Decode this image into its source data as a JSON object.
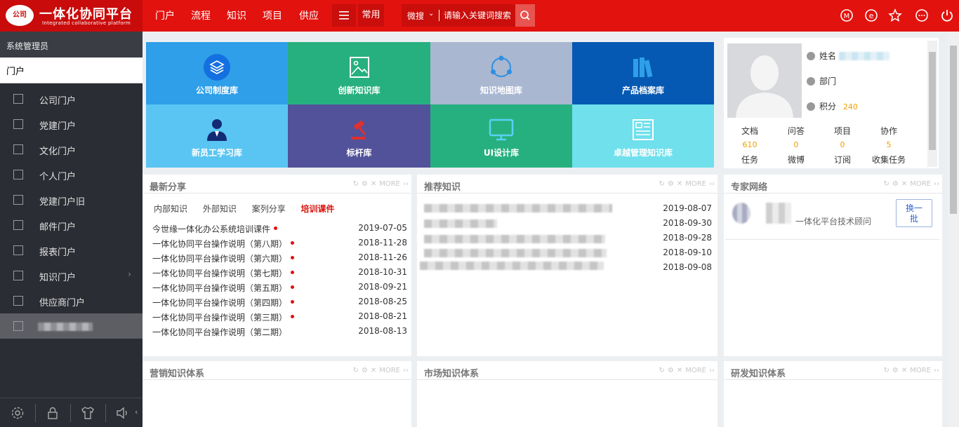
{
  "app": {
    "title": "一体化协同平台",
    "subtitle": "Integrated collaborative platform",
    "seal_text": "公司"
  },
  "topnav": [
    "门户",
    "流程",
    "知识",
    "项目",
    "供应"
  ],
  "toolbar": {
    "menu_icon": "menu-icon",
    "common_label": "常用"
  },
  "search": {
    "scope": "微搜",
    "placeholder": "请输入关键词搜索"
  },
  "top_icons": [
    "m-icon",
    "e-icon",
    "star-icon",
    "more-icon",
    "power-icon"
  ],
  "sidebar": {
    "user": "系统管理员",
    "section": "门户",
    "items": [
      {
        "label": "公司门户"
      },
      {
        "label": "党建门户"
      },
      {
        "label": "文化门户"
      },
      {
        "label": "个人门户"
      },
      {
        "label": "党建门户旧"
      },
      {
        "label": "邮件门户"
      },
      {
        "label": "报表门户"
      },
      {
        "label": "知识门户"
      },
      {
        "label": "供应商门户"
      }
    ],
    "bottom_icons": [
      "settings-icon",
      "lock-icon",
      "shirt-icon",
      "speaker-icon"
    ]
  },
  "tiles": [
    {
      "label": "公司制度库",
      "color": "#2e9fe8"
    },
    {
      "label": "创新知识库",
      "color": "#27b07f"
    },
    {
      "label": "知识地图库",
      "color": "#a9b7d1"
    },
    {
      "label": "产品档案库",
      "color": "#0559b3"
    },
    {
      "label": "新员工学习库",
      "color": "#5ac5f2"
    },
    {
      "label": "标杆库",
      "color": "#52529a"
    },
    {
      "label": "UI设计库",
      "color": "#27b07f"
    },
    {
      "label": "卓越管理知识库",
      "color": "#6fe0ec"
    }
  ],
  "profile": {
    "name_label": "姓名",
    "dept_label": "部门",
    "points_label": "积分",
    "points_value": "240",
    "stats_row1": [
      "文档",
      "问答",
      "项目",
      "协作"
    ],
    "stats_values": [
      "610",
      "0",
      "0",
      "5"
    ],
    "stats_row2": [
      "任务",
      "微博",
      "订阅",
      "收集任务"
    ]
  },
  "panels": {
    "latest": {
      "title": "最新分享",
      "more": "MORE",
      "tabs": [
        "内部知识",
        "外部知识",
        "案列分享",
        "培训课件"
      ],
      "rows": [
        {
          "title": "今世缘一体化办公系统培训课件",
          "date": "2019-07-05"
        },
        {
          "title": "一体化协同平台操作说明（第八期）",
          "date": "2018-11-28"
        },
        {
          "title": "一体化协同平台操作说明（第六期）",
          "date": "2018-11-26"
        },
        {
          "title": "一体化协同平台操作说明（第七期）",
          "date": "2018-10-31"
        },
        {
          "title": "一体化协同平台操作说明（第五期）",
          "date": "2018-09-21"
        },
        {
          "title": "一体化协同平台操作说明（第四期）",
          "date": "2018-08-25"
        },
        {
          "title": "一体化协同平台操作说明（第三期）",
          "date": "2018-08-21"
        },
        {
          "title": "一体化协同平台操作说明（第二期）",
          "date": "2018-08-13"
        }
      ]
    },
    "recommend": {
      "title": "推荐知识",
      "more": "MORE",
      "dates": [
        "2019-08-07",
        "2018-09-30",
        "2018-09-28",
        "2018-09-10",
        "2018-09-08"
      ]
    },
    "expert": {
      "title": "专家网络",
      "more": "MORE",
      "expert_role": "一体化平台技术顾问",
      "refresh_label": "换一批"
    },
    "marketing": {
      "title": "营销知识体系",
      "more": "MORE"
    },
    "market": {
      "title": "市场知识体系",
      "more": "MORE"
    },
    "rd": {
      "title": "研发知识体系",
      "more": "MORE"
    }
  }
}
